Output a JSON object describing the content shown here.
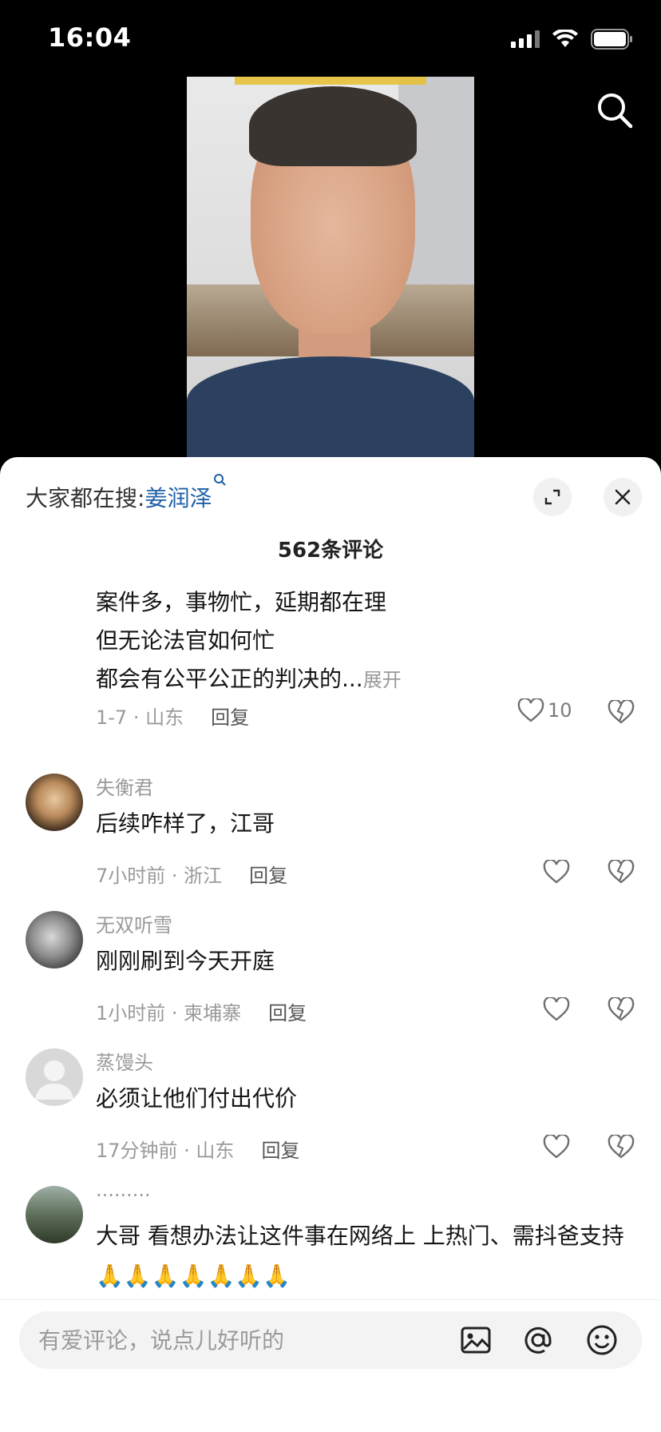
{
  "status_bar": {
    "time": "16:04"
  },
  "sheet": {
    "hot_search_prefix": "大家都在搜: ",
    "hot_search_keyword": "姜润泽",
    "comment_count": "562条评论"
  },
  "first_comment": {
    "lines": [
      "案件多，事物忙，延期都在理",
      "但无论法官如何忙",
      "都会有公平公正的判决的..."
    ],
    "expand_label": "展开",
    "meta": "1-7 · 山东",
    "reply_label": "回复",
    "like_count": "10"
  },
  "comments": [
    {
      "name": "失衡君",
      "text": "后续咋样了，江哥",
      "meta": "7小时前 · 浙江",
      "reply_label": "回复"
    },
    {
      "name": "无双听雪",
      "text": "刚刚刷到今天开庭",
      "meta": "1小时前 · 柬埔寨",
      "reply_label": "回复"
    },
    {
      "name": "蒸馒头",
      "text": "必须让他们付出代价",
      "meta": "17分钟前 · 山东",
      "reply_label": "回复"
    },
    {
      "name": "·········",
      "text": "大哥 看想办法让这件事在网络上 上热门、需抖爸支持🙏🙏🙏🙏🙏🙏🙏"
    }
  ],
  "input": {
    "placeholder": "有爱评论，说点儿好听的"
  },
  "colors": {
    "keyword": "#1f5fa8",
    "sheet_bg": "#ffffff",
    "meta_gray": "#9a9a9a"
  }
}
